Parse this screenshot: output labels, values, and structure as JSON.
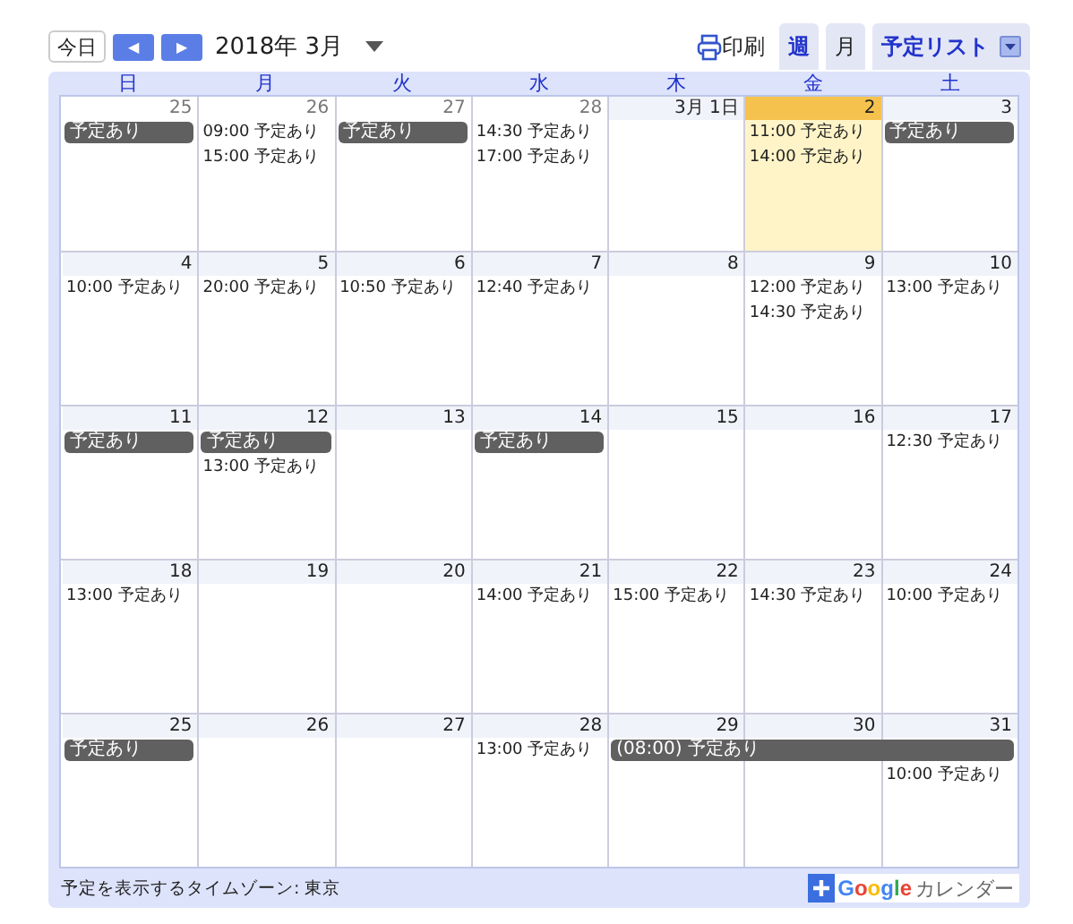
{
  "toolbar": {
    "today_button": "今日",
    "prev_button": "◀",
    "next_button": "▶",
    "month_label": "2018年 3月",
    "print_label": "印刷",
    "views": [
      {
        "label": "週",
        "selected": false
      },
      {
        "label": "月",
        "selected": true
      },
      {
        "label": "予定リスト",
        "selected": false
      }
    ]
  },
  "weekdays": [
    "日",
    "月",
    "火",
    "水",
    "木",
    "金",
    "土"
  ],
  "weeks": [
    {
      "days": [
        {
          "date": "25",
          "other_month": true,
          "today": false,
          "events": [
            {
              "kind": "allday",
              "text": "予定あり"
            }
          ]
        },
        {
          "date": "26",
          "other_month": true,
          "today": false,
          "events": [
            {
              "kind": "timed",
              "text": "09:00 予定あり"
            },
            {
              "kind": "timed",
              "text": "15:00 予定あり"
            }
          ]
        },
        {
          "date": "27",
          "other_month": true,
          "today": false,
          "events": [
            {
              "kind": "allday",
              "text": "予定あり"
            }
          ]
        },
        {
          "date": "28",
          "other_month": true,
          "today": false,
          "events": [
            {
              "kind": "timed",
              "text": "14:30 予定あり"
            },
            {
              "kind": "timed",
              "text": "17:00 予定あり"
            }
          ]
        },
        {
          "date": "3月 1日",
          "other_month": false,
          "today": false
        },
        {
          "date": "2",
          "other_month": false,
          "today": true,
          "events": [
            {
              "kind": "timed",
              "text": "11:00 予定あり"
            },
            {
              "kind": "timed",
              "text": "14:00 予定あり"
            }
          ]
        },
        {
          "date": "3",
          "other_month": false,
          "today": false,
          "events": [
            {
              "kind": "allday",
              "text": "予定あり"
            }
          ]
        }
      ]
    },
    {
      "days": [
        {
          "date": "4",
          "other_month": false,
          "today": false,
          "events": [
            {
              "kind": "timed",
              "text": "10:00 予定あり"
            }
          ]
        },
        {
          "date": "5",
          "other_month": false,
          "today": false,
          "events": [
            {
              "kind": "timed",
              "text": "20:00 予定あり"
            }
          ]
        },
        {
          "date": "6",
          "other_month": false,
          "today": false,
          "events": [
            {
              "kind": "timed",
              "text": "10:50 予定あり"
            }
          ]
        },
        {
          "date": "7",
          "other_month": false,
          "today": false,
          "events": [
            {
              "kind": "timed",
              "text": "12:40 予定あり"
            }
          ]
        },
        {
          "date": "8",
          "other_month": false,
          "today": false
        },
        {
          "date": "9",
          "other_month": false,
          "today": false,
          "events": [
            {
              "kind": "timed",
              "text": "12:00 予定あり"
            },
            {
              "kind": "timed",
              "text": "14:30 予定あり"
            }
          ]
        },
        {
          "date": "10",
          "other_month": false,
          "today": false,
          "events": [
            {
              "kind": "timed",
              "text": "13:00 予定あり"
            }
          ]
        }
      ]
    },
    {
      "days": [
        {
          "date": "11",
          "other_month": false,
          "today": false,
          "events": [
            {
              "kind": "allday",
              "text": "予定あり"
            }
          ]
        },
        {
          "date": "12",
          "other_month": false,
          "today": false,
          "events": [
            {
              "kind": "allday",
              "text": "予定あり"
            },
            {
              "kind": "timed",
              "text": "13:00 予定あり"
            }
          ]
        },
        {
          "date": "13",
          "other_month": false,
          "today": false
        },
        {
          "date": "14",
          "other_month": false,
          "today": false,
          "events": [
            {
              "kind": "allday",
              "text": "予定あり"
            }
          ]
        },
        {
          "date": "15",
          "other_month": false,
          "today": false
        },
        {
          "date": "16",
          "other_month": false,
          "today": false
        },
        {
          "date": "17",
          "other_month": false,
          "today": false,
          "events": [
            {
              "kind": "timed",
              "text": "12:30 予定あり"
            }
          ]
        }
      ]
    },
    {
      "days": [
        {
          "date": "18",
          "other_month": false,
          "today": false,
          "events": [
            {
              "kind": "timed",
              "text": "13:00 予定あり"
            }
          ]
        },
        {
          "date": "19",
          "other_month": false,
          "today": false
        },
        {
          "date": "20",
          "other_month": false,
          "today": false
        },
        {
          "date": "21",
          "other_month": false,
          "today": false,
          "events": [
            {
              "kind": "timed",
              "text": "14:00 予定あり"
            }
          ]
        },
        {
          "date": "22",
          "other_month": false,
          "today": false,
          "events": [
            {
              "kind": "timed",
              "text": "15:00 予定あり"
            }
          ]
        },
        {
          "date": "23",
          "other_month": false,
          "today": false,
          "events": [
            {
              "kind": "timed",
              "text": "14:30 予定あり"
            }
          ]
        },
        {
          "date": "24",
          "other_month": false,
          "today": false,
          "events": [
            {
              "kind": "timed",
              "text": "10:00 予定あり"
            }
          ]
        }
      ]
    },
    {
      "days": [
        {
          "date": "25",
          "other_month": false,
          "today": false,
          "events": [
            {
              "kind": "allday",
              "text": "予定あり"
            }
          ]
        },
        {
          "date": "26",
          "other_month": false,
          "today": false
        },
        {
          "date": "27",
          "other_month": false,
          "today": false
        },
        {
          "date": "28",
          "other_month": false,
          "today": false,
          "events": [
            {
              "kind": "timed",
              "text": "13:00 予定あり"
            }
          ]
        },
        {
          "date": "29",
          "other_month": false,
          "today": false,
          "events": [
            {
              "kind": "allday",
              "text": "(08:00) 予定あり"
            }
          ]
        },
        {
          "date": "30",
          "other_month": false,
          "today": false,
          "events": [
            {
              "kind": "continued"
            }
          ]
        },
        {
          "date": "31",
          "other_month": false,
          "today": false,
          "events": [
            {
              "kind": "continued"
            },
            {
              "kind": "timed",
              "text": "10:00 予定あり"
            }
          ]
        }
      ]
    }
  ],
  "footer": {
    "timezone": "予定を表示するタイムゾーン: 東京",
    "brand": "Google",
    "brand_suffix": "カレンダー"
  }
}
